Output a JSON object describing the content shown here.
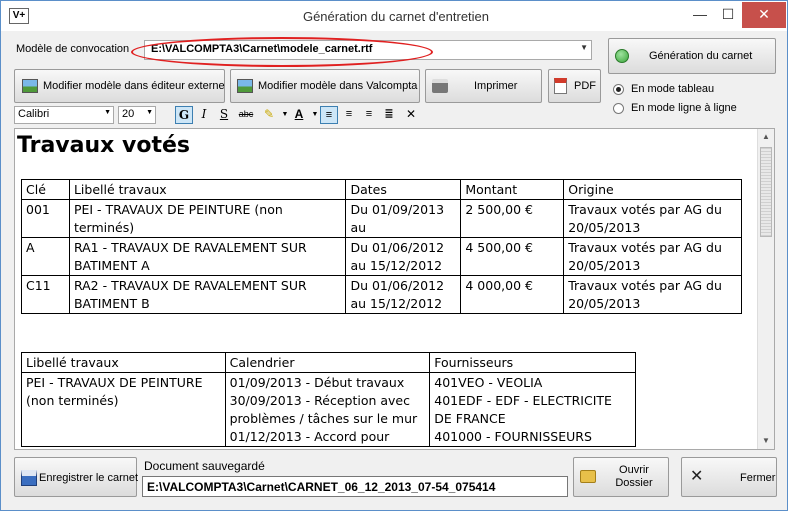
{
  "window": {
    "title": "Génération du carnet d'entretien",
    "app_icon_text": "V+",
    "minimize_glyph": "—",
    "maximize_glyph": "☐",
    "close_glyph": "✕"
  },
  "convocation": {
    "label": "Modèle de convocation",
    "value": "E:\\VALCOMPTA3\\Carnet\\modele_carnet.rtf"
  },
  "toolbar": {
    "generate": "Génération du carnet",
    "edit_external": "Modifier modèle dans éditeur externe",
    "edit_valcompta": "Modifier modèle dans Valcompta",
    "print": "Imprimer",
    "pdf": "PDF"
  },
  "mode": {
    "table": "En mode tableau",
    "line": "En mode ligne à ligne",
    "selected": "table"
  },
  "format": {
    "font": "Calibri",
    "size": "20",
    "bold": "G",
    "italic": "I",
    "underline": "S",
    "strike": "abc",
    "font_color": "A",
    "close": "✕"
  },
  "document": {
    "heading": "Travaux votés",
    "table1": {
      "headers": [
        "Clé",
        "Libellé travaux",
        "Dates",
        "Montant",
        "Origine"
      ],
      "rows": [
        [
          "001",
          "PEI - TRAVAUX DE  PEINTURE (non terminés)",
          "Du 01/09/2013 au",
          "2 500,00 €",
          "Travaux votés par AG du 20/05/2013"
        ],
        [
          "A",
          "RA1 - TRAVAUX DE RAVALEMENT SUR BATIMENT A",
          "Du 01/06/2012 au 15/12/2012",
          "4 500,00 €",
          "Travaux votés par AG du 20/05/2013"
        ],
        [
          "C11",
          "RA2 - TRAVAUX DE RAVALEMENT SUR BATIMENT B",
          "Du 01/06/2012 au 15/12/2012",
          "4 000,00 €",
          "Travaux votés par AG du 20/05/2013"
        ]
      ]
    },
    "table2": {
      "headers": [
        "Libellé travaux",
        "Calendrier",
        "Fournisseurs"
      ],
      "row": {
        "libelle": "PEI - TRAVAUX DE  PEINTURE (non terminés)",
        "calendrier": [
          "01/09/2013 - Début travaux",
          "30/09/2013 - Réception avec problèmes / tâches sur le mur",
          "01/12/2013 - Accord pour"
        ],
        "fournisseurs": [
          "401VEO - VEOLIA",
          "401EDF - EDF - ELECTRICITE DE FRANCE",
          "401000 - FOURNISSEURS"
        ]
      }
    }
  },
  "footer": {
    "save_button": "Enregistrer le carnet",
    "saved_label": "Document sauvegardé",
    "saved_path": "E:\\VALCOMPTA3\\Carnet\\CARNET_06_12_2013_07-54_075414",
    "open_folder": "Ouvrir Dossier",
    "close_button": "Fermer"
  },
  "colors": {
    "accent_border": "#5b8fc9",
    "close_button": "#c7504b",
    "highlight_ellipse": "#e02020",
    "generate_icon": "#3aa53a"
  }
}
